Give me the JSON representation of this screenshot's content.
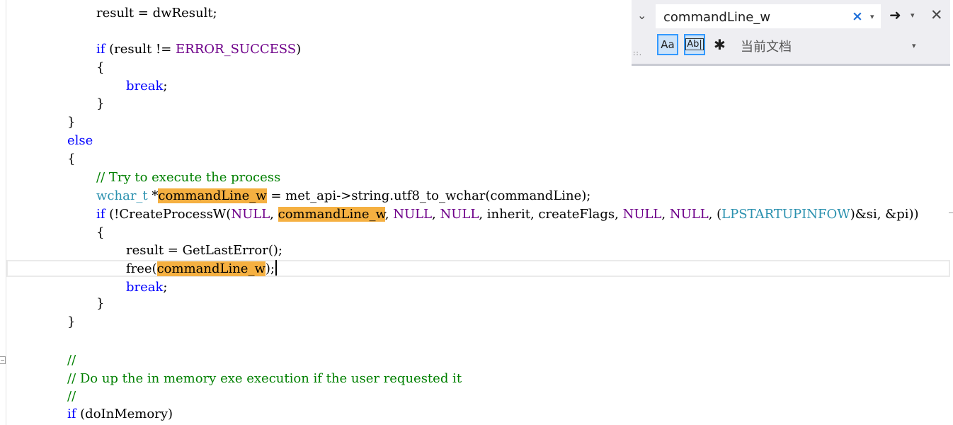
{
  "find": {
    "query": "commandLine_w",
    "clear_icon": "×",
    "dropdown_icon": "▾",
    "next_icon": "➜",
    "close_icon": "✕",
    "toggle_icon": "⌄",
    "match_case_label": "Aa",
    "whole_word_label": "Ab|",
    "regex_label": "✱",
    "scope": "当前文档",
    "grip": "::."
  },
  "code": {
    "l1": "result = dwResult;",
    "l2_if": "if",
    "l2_a": " (result != ",
    "l2_mac": "ERROR_SUCCESS",
    "l2_b": ")",
    "brace_open": "{",
    "brace_close": "}",
    "break_kw": "break",
    "semicolon": ";",
    "else_kw": "else",
    "comment_try": "// Try to execute the process",
    "wchar_t": "wchar_t",
    "star": " *",
    "hit": "commandLine_w",
    "l_wchar_rest": " = met_api->string.utf8_to_wchar(commandLine);",
    "l_cp_a": " (!CreateProcessW(",
    "null": "NULL",
    "comma_sp": ", ",
    "l_cp_mid": "inherit, createFlags, ",
    "l_cp_cast_open": "(",
    "lpstartup": "LPSTARTUPINFOW",
    "l_cp_end": ")&si, &pi))",
    "l_result_gle": "result = GetLastError();",
    "free_a": "free(",
    "free_b": ");",
    "comment_slash": "//",
    "comment_doup": "// Do up the in memory exe execution if the user requested it",
    "l_if_mem": " (doInMemory)"
  }
}
